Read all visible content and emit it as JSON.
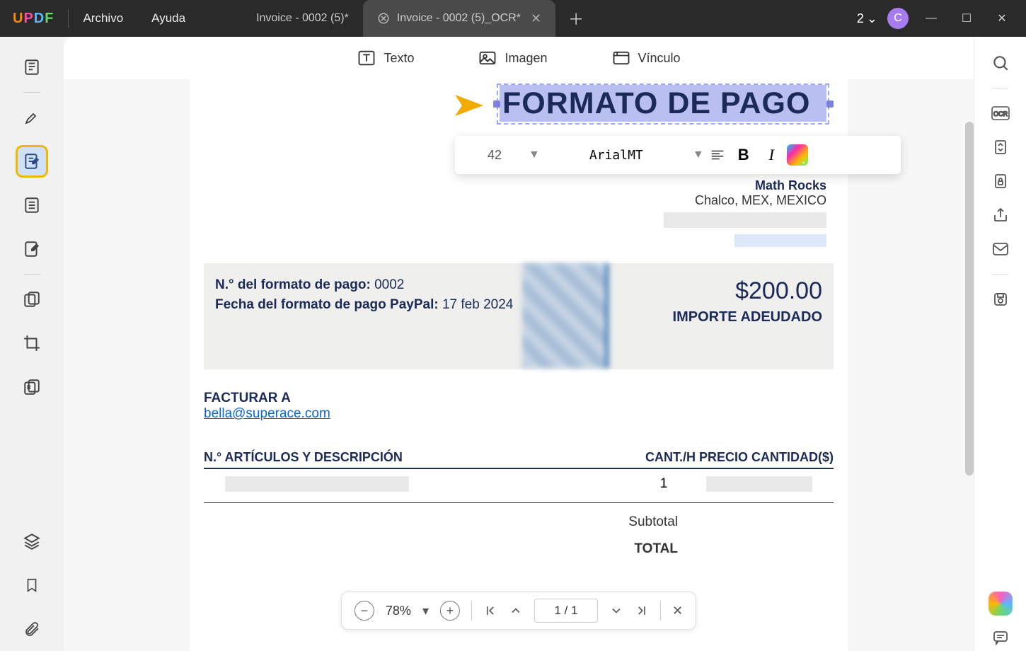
{
  "titlebar": {
    "logo": "UPDF",
    "menu": {
      "file": "Archivo",
      "help": "Ayuda"
    },
    "tabs": [
      {
        "title": "Invoice - 0002 (5)*",
        "active": false
      },
      {
        "title": "Invoice - 0002 (5)_OCR*",
        "active": true
      }
    ],
    "tab_count": "2",
    "avatar_initial": "C"
  },
  "top_tools": {
    "text": "Texto",
    "image": "Imagen",
    "link": "Vínculo"
  },
  "floating_toolbar": {
    "font_size": "42",
    "font_name": "ArialMT"
  },
  "document": {
    "heading": "FORMATO DE PAGO",
    "company_line": "Math Rocks",
    "address_line": "Chalco, MEX, MEXICO",
    "invoice_no_label": "N.° del formato de pago:",
    "invoice_no": "0002",
    "date_label": "Fecha del formato de pago PayPal:",
    "date_value": "17 feb 2024",
    "amount": "$200.00",
    "amount_label": "IMPORTE ADEUDADO",
    "bill_to_label": "FACTURAR A",
    "bill_to_email": "bella@superace.com",
    "table_header_left": "N.° ARTÍCULOS Y DESCRIPCIÓN",
    "table_header_right": "CANT./H PRECIO CANTIDAD($)",
    "row_qty": "1",
    "subtotal_label": "Subtotal",
    "total_label": "TOTAL"
  },
  "bottom_bar": {
    "zoom": "78%",
    "page": "1  /  1"
  }
}
